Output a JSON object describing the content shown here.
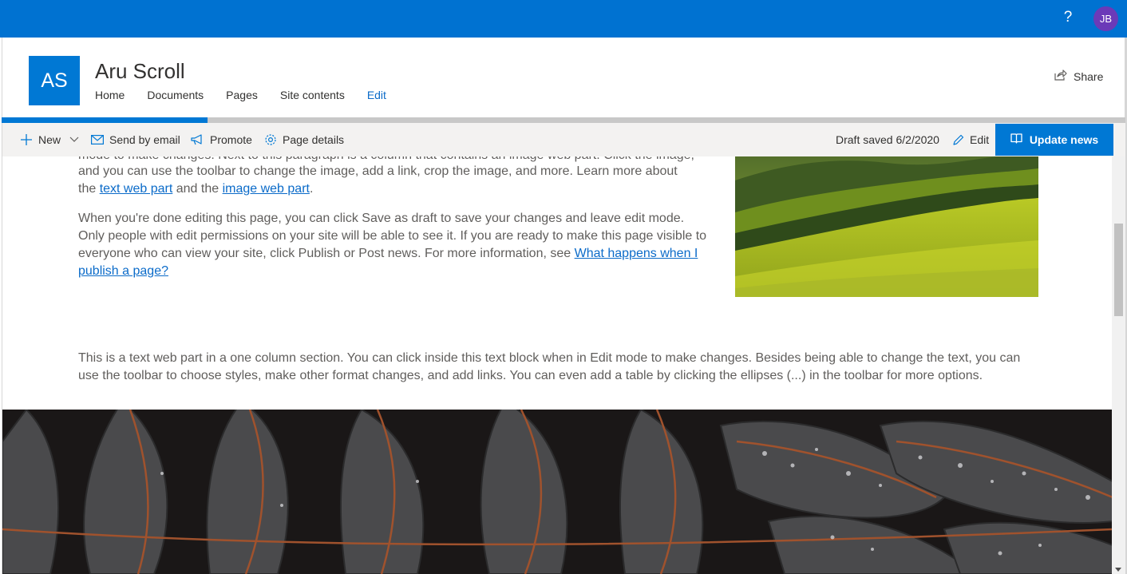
{
  "suite": {
    "help_glyph": "?",
    "avatar_initials": "JB",
    "bar_color": "#0072d1"
  },
  "site": {
    "logo_initials": "AS",
    "title": "Aru Scroll",
    "nav": [
      {
        "label": "Home"
      },
      {
        "label": "Documents"
      },
      {
        "label": "Pages"
      },
      {
        "label": "Site contents"
      },
      {
        "label": "Edit"
      }
    ],
    "share_label": "Share"
  },
  "progress": {
    "fraction": 0.183
  },
  "commandbar": {
    "new_label": "New",
    "send_email_label": "Send by email",
    "promote_label": "Promote",
    "page_details_label": "Page details",
    "draft_status": "Draft saved 6/2/2020",
    "edit_label": "Edit",
    "update_label": "Update news"
  },
  "content": {
    "para1": {
      "partial_first": "mode to make changes. Next to this paragraph is a column that contains an image web part. Click the image,",
      "line2": "and you can use the toolbar to change the image, add a link, crop the image, and more. Learn more about",
      "prefix": "the ",
      "link1": "text web part",
      "mid": " and the ",
      "link2": "image web part",
      "suffix": "."
    },
    "para2": {
      "text": "When you're done editing this page, you can click Save as draft to save your changes and leave edit mode. Only people with edit permissions on your site will be able to see it. If you are ready to make this page visible to everyone who can view your site, click Publish or Post news. For more information, see ",
      "link": "What happens when I publish a page? "
    },
    "para3": "This is a text web part in a one column section. You can click inside this text block when in Edit mode to make changes. Besides being able to change the text, you can use the toolbar to choose styles, make other format changes, and add links. You can even add a table by clicking the ellipses (...) in the toolbar for more options."
  },
  "icons": {
    "help": "question-icon",
    "share": "share-icon",
    "new": "plus-icon",
    "dropdown": "chevron-down-icon",
    "email": "mail-icon",
    "promote": "megaphone-icon",
    "details": "gear-icon",
    "edit": "pencil-icon",
    "update": "book-icon"
  }
}
